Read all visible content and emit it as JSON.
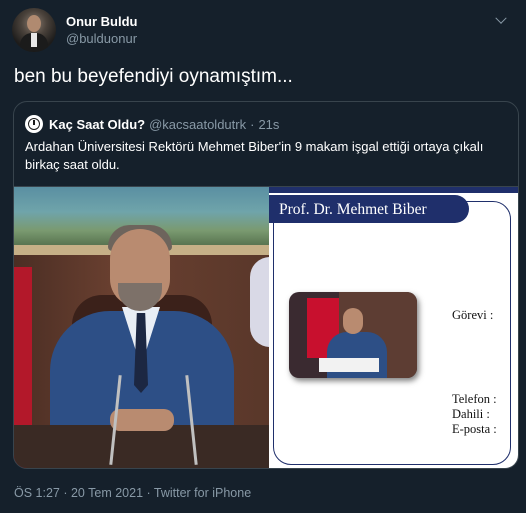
{
  "author": {
    "display_name": "Onur Buldu",
    "handle": "@bulduonur"
  },
  "tweet": {
    "text": "ben bu beyefendiyi oynamıştım...",
    "meta": "ÖS 1:27 · 20 Tem 2021 · Twitter for iPhone"
  },
  "quoted": {
    "display_name": "Kaç Saat Oldu?",
    "handle": "@kacsaatoldutrk",
    "separator": "·",
    "time": "21s",
    "text": "Ardahan Üniversitesi Rektörü Mehmet Biber'in 9 makam işgal ettiği ortaya çıkalı birkaç saat oldu.",
    "image": {
      "card_title": "Prof. Dr. Mehmet Biber",
      "label_gorevi": "Görevi :",
      "label_telefon": "Telefon :",
      "label_dahili": "Dahili :",
      "label_eposta": "E-posta :"
    }
  },
  "colors": {
    "background": "#15202b",
    "border": "#38444d",
    "muted_text": "#8899a6",
    "card_navy": "#1f2f6b"
  },
  "icons": {
    "more": "chevron-down-icon",
    "quoted_avatar": "clock-icon"
  }
}
